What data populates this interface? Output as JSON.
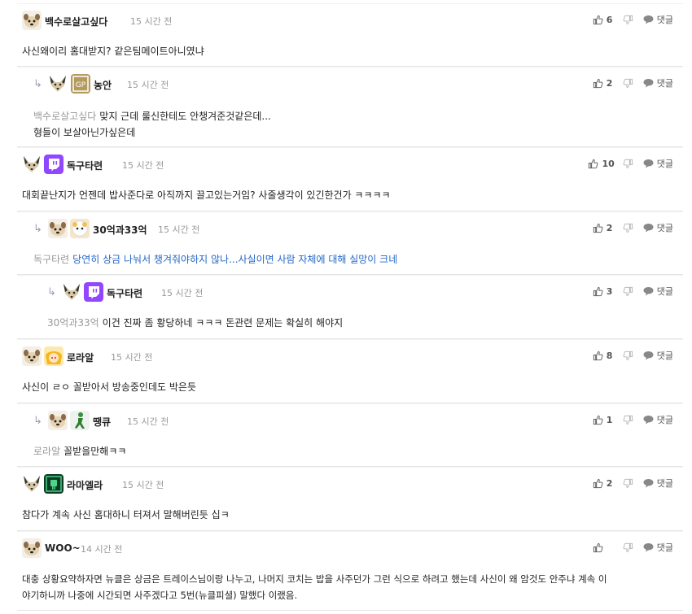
{
  "comments": [
    {
      "nick": "백수로살고싶다",
      "time": "15 시간 전",
      "likes": "6",
      "mention": "",
      "text": "사신왜이리 홈대받지? 같은팀메이트아니였냐",
      "text2": "",
      "reply_label": "댓글",
      "avatar_icons": [
        "dog-avatar-icon"
      ]
    },
    {
      "nick": "농안",
      "time": "15 시간 전",
      "likes": "2",
      "mention": "백수로살고싶다",
      "text": "맞지 근데 룰신한테도 안챙겨준것같은데...",
      "text2": "형들이 보살아닌가싶은데",
      "reply_label": "댓글",
      "avatar_icons": [
        "fox-avatar-icon",
        "gp-badge-icon"
      ]
    },
    {
      "nick": "독구타련",
      "time": "15 시간 전",
      "likes": "10",
      "mention": "",
      "text": "대회끝난지가 언젠데 밥사준다로 아직까지 끌고있는거임? 사줄생각이 있긴한건가 ㅋㅋㅋㅋ",
      "text2": "",
      "reply_label": "댓글",
      "avatar_icons": [
        "fox-avatar-icon",
        "twitch-icon"
      ]
    },
    {
      "nick": "30억과33억",
      "time": "15 시간 전",
      "likes": "2",
      "mention": "독구타련",
      "text": "당연히 상금 나눠서 챙겨줘야하지 않나...사실이면 사람 자체에 대해 실망이 크네",
      "text2": "",
      "reply_label": "댓글",
      "avatar_icons": [
        "dog-avatar-icon",
        "sheep-avatar-icon"
      ]
    },
    {
      "nick": "독구타련",
      "time": "15 시간 전",
      "likes": "3",
      "mention": "30억과33억",
      "text": "이건 진짜 좀 황당하네 ㅋㅋㅋ 돈관련 문제는 확실히 해야지",
      "text2": "",
      "reply_label": "댓글",
      "avatar_icons": [
        "fox-avatar-icon",
        "twitch-icon"
      ]
    },
    {
      "nick": "로라알",
      "time": "15 시간 전",
      "likes": "8",
      "mention": "",
      "text": "사신이 ㄹㅇ 꼴받아서 방송중인데도 박은듯",
      "text2": "",
      "reply_label": "댓글",
      "avatar_icons": [
        "dog-avatar-icon",
        "anime-avatar-icon"
      ]
    },
    {
      "nick": "땡큐",
      "time": "15 시간 전",
      "likes": "1",
      "mention": "로라알",
      "text": "꼴받을만해ㅋㅋ",
      "text2": "",
      "reply_label": "댓글",
      "avatar_icons": [
        "dog-avatar-icon",
        "green-figure-icon"
      ]
    },
    {
      "nick": "라마엘라",
      "time": "15 시간 전",
      "likes": "2",
      "mention": "",
      "text": "참다가 계속 사신 홈대하니 터져서 말해버린듯 십ㅋ",
      "text2": "",
      "reply_label": "댓글",
      "avatar_icons": [
        "fox-avatar-icon",
        "robot-badge-icon"
      ]
    },
    {
      "nick": "WOO~",
      "time": "14 시간 전",
      "likes": "",
      "mention": "",
      "text": "대충 상황요약하자면 뉴클은 상금은 트레이스님이랑 나누고, 나머지 코치는 밥을 사주던가 그런 식으로 하려고 했는데 사신이 왜 암것도 안주냐 계속 이",
      "text2": "야기하니까 나중에 시간되면 사주겠다고 5번(뉴클피셜) 말했다 이랬음.",
      "reply_label": "댓글",
      "avatar_icons": [
        "dog-avatar-icon"
      ]
    }
  ]
}
